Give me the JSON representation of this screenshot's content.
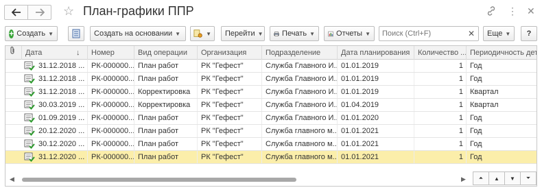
{
  "window": {
    "title": "План-графики ППР",
    "back_icon": "arrow-left-icon",
    "forward_icon": "arrow-right-icon"
  },
  "toolbar": {
    "create_label": "Создать",
    "create_based_label": "Создать на основании",
    "goto_label": "Перейти",
    "print_label": "Печать",
    "reports_label": "Отчеты",
    "search_placeholder": "Поиск (Ctrl+F)",
    "search_value": "",
    "more_label": "Еще",
    "help_label": "?"
  },
  "table": {
    "columns": [
      {
        "label": "Дата",
        "sort": "desc"
      },
      {
        "label": "Номер"
      },
      {
        "label": "Вид операции"
      },
      {
        "label": "Организация"
      },
      {
        "label": "Подразделение"
      },
      {
        "label": "Дата планирования"
      },
      {
        "label": "Количество ..."
      },
      {
        "label": "Периодичность дет"
      }
    ],
    "rows": [
      {
        "date": "31.12.2018 ...",
        "number": "РК-000000...",
        "op": "План работ",
        "org": "РК \"Гефест\"",
        "dept": "Служба Главного И...",
        "plan_date": "01.01.2019",
        "qty": "1",
        "period": "Год",
        "selected": false
      },
      {
        "date": "31.12.2018 ...",
        "number": "РК-000000...",
        "op": "План работ",
        "org": "РК \"Гефест\"",
        "dept": "Служба Главного И...",
        "plan_date": "01.01.2019",
        "qty": "1",
        "period": "Год",
        "selected": false
      },
      {
        "date": "31.12.2018 ...",
        "number": "РК-000000...",
        "op": "Корректировка",
        "org": "РК \"Гефест\"",
        "dept": "Служба Главного И...",
        "plan_date": "01.01.2019",
        "qty": "1",
        "period": "Квартал",
        "selected": false
      },
      {
        "date": "30.03.2019 ...",
        "number": "РК-000000...",
        "op": "Корректировка",
        "org": "РК \"Гефест\"",
        "dept": "Служба Главного И...",
        "plan_date": "01.04.2019",
        "qty": "1",
        "period": "Квартал",
        "selected": false
      },
      {
        "date": "01.09.2019 ...",
        "number": "РК-000000...",
        "op": "План работ",
        "org": "РК \"Гефест\"",
        "dept": "Служба Главного И...",
        "plan_date": "01.01.2020",
        "qty": "1",
        "period": "Год",
        "selected": false
      },
      {
        "date": "20.12.2020 ...",
        "number": "РК-000000...",
        "op": "План работ",
        "org": "РК \"Гефест\"",
        "dept": "Служба главного м...",
        "plan_date": "01.01.2021",
        "qty": "1",
        "period": "Год",
        "selected": false
      },
      {
        "date": "30.12.2020 ...",
        "number": "РК-000000...",
        "op": "План работ",
        "org": "РК \"Гефест\"",
        "dept": "Служба главного м...",
        "plan_date": "01.01.2021",
        "qty": "1",
        "period": "Год",
        "selected": false
      },
      {
        "date": "31.12.2020 ...",
        "number": "РК-000000...",
        "op": "План работ",
        "org": "РК \"Гефест\"",
        "dept": "Служба главного м...",
        "plan_date": "01.01.2021",
        "qty": "1",
        "period": "Год",
        "selected": true
      }
    ]
  },
  "colors": {
    "selected_row": "#fbeeaa",
    "accent_green": "#3aa43a"
  }
}
